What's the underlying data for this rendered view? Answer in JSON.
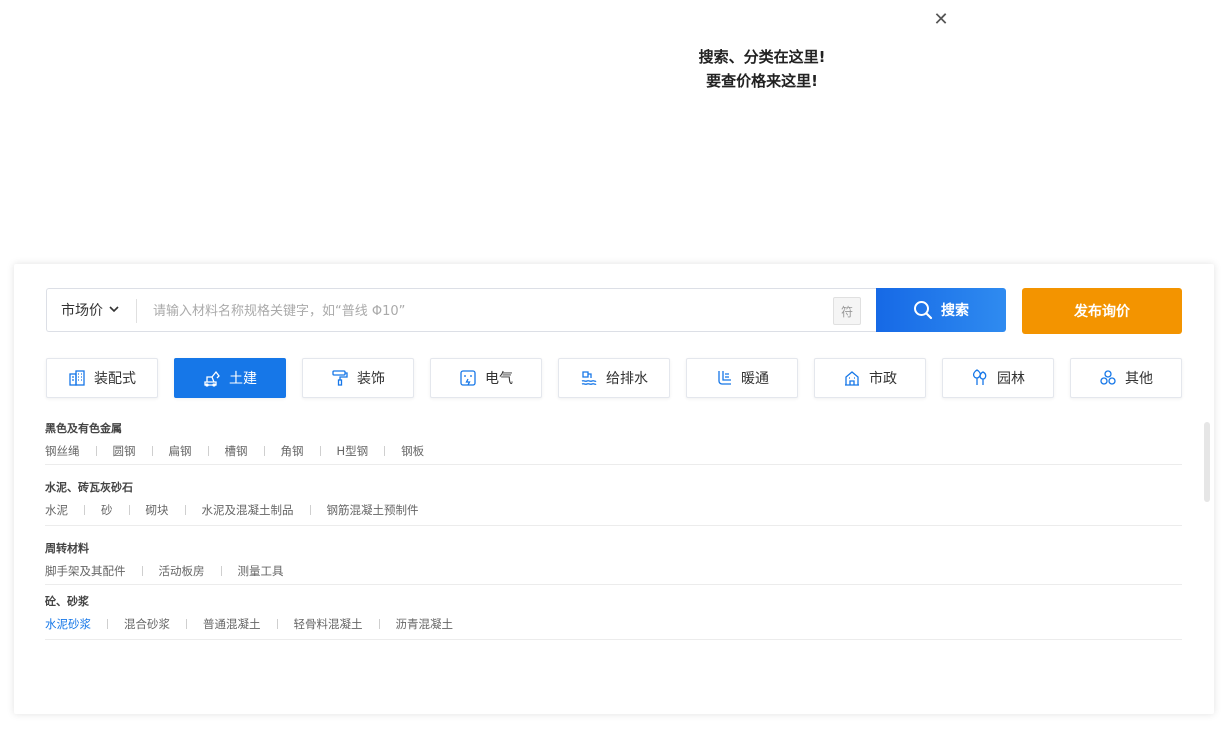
{
  "tooltip": {
    "line1": "搜索、分类在这里!",
    "line2": "要查价格来这里!",
    "close": "✕"
  },
  "search": {
    "price_type": "市场价",
    "placeholder": "请输入材料名称规格关键字，如“普线 Φ10”",
    "symbol_label": "符",
    "button_label": "搜索"
  },
  "publish_label": "发布询价",
  "categories": [
    {
      "label": "装配式",
      "icon": "building-icon"
    },
    {
      "label": "土建",
      "icon": "excavator-icon"
    },
    {
      "label": "装饰",
      "icon": "paint-roller-icon"
    },
    {
      "label": "电气",
      "icon": "socket-icon"
    },
    {
      "label": "给排水",
      "icon": "water-icon"
    },
    {
      "label": "暖通",
      "icon": "pipe-icon"
    },
    {
      "label": "市政",
      "icon": "city-building-icon"
    },
    {
      "label": "园林",
      "icon": "tree-icon"
    },
    {
      "label": "其他",
      "icon": "layers-icon"
    }
  ],
  "active_category": "土建",
  "colors": {
    "primary": "#1677e8",
    "publish": "#f39400"
  },
  "groups": [
    {
      "title": "黑色及有色金属",
      "items": [
        "钢丝绳",
        "圆钢",
        "扁钢",
        "槽钢",
        "角钢",
        "H型钢",
        "钢板"
      ]
    },
    {
      "title": "水泥、砖瓦灰砂石",
      "items": [
        "水泥",
        "砂",
        "砌块",
        "水泥及混凝土制品",
        "钢筋混凝土预制件"
      ]
    },
    {
      "title": "周转材料",
      "items": [
        "脚手架及其配件",
        "活动板房",
        "测量工具"
      ]
    },
    {
      "title": "砼、砂浆",
      "items": [
        "水泥砂浆",
        "混合砂浆",
        "普通混凝土",
        "轻骨料混凝土",
        "沥青混凝土"
      ]
    }
  ],
  "active_item": "水泥砂浆"
}
